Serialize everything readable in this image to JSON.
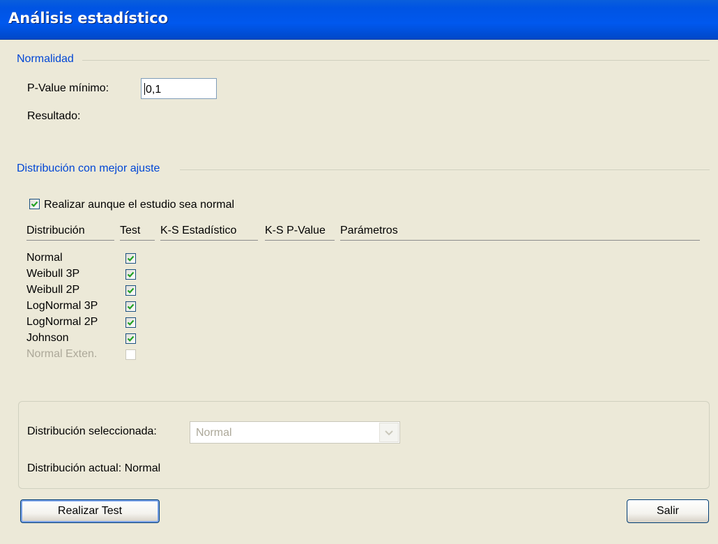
{
  "window": {
    "title": "Análisis estadístico"
  },
  "normalidad": {
    "group_title": "Normalidad",
    "pvalue_label": "P-Value mínimo:",
    "pvalue_value": "0,1",
    "resultado_label": "Resultado:"
  },
  "ajuste": {
    "group_title": "Distribución con mejor ajuste",
    "realizar_checkbox_label": "Realizar aunque el estudio sea normal",
    "realizar_checked": true,
    "columns": {
      "distribucion": "Distribución",
      "test": "Test",
      "ks_estadistico": "K-S Estadístico",
      "ks_pvalue": "K-S P-Value",
      "parametros": "Parámetros"
    },
    "rows": [
      {
        "name": "Normal",
        "checked": true,
        "enabled": true
      },
      {
        "name": "Weibull 3P",
        "checked": true,
        "enabled": true
      },
      {
        "name": "Weibull 2P",
        "checked": true,
        "enabled": true
      },
      {
        "name": "LogNormal 3P",
        "checked": true,
        "enabled": true
      },
      {
        "name": "LogNormal 2P",
        "checked": true,
        "enabled": true
      },
      {
        "name": "Johnson",
        "checked": true,
        "enabled": true
      },
      {
        "name": "Normal Exten.",
        "checked": false,
        "enabled": false
      }
    ]
  },
  "seleccion": {
    "selected_label": "Distribución seleccionada:",
    "selected_value": "Normal",
    "actual_label": "Distribución actual: Normal"
  },
  "buttons": {
    "realizar_test": "Realizar Test",
    "salir": "Salir"
  },
  "colors": {
    "title_bar": "#0054e3",
    "group_title": "#0046d5",
    "window_bg": "#ece9d8",
    "check_mark": "#21a121"
  }
}
